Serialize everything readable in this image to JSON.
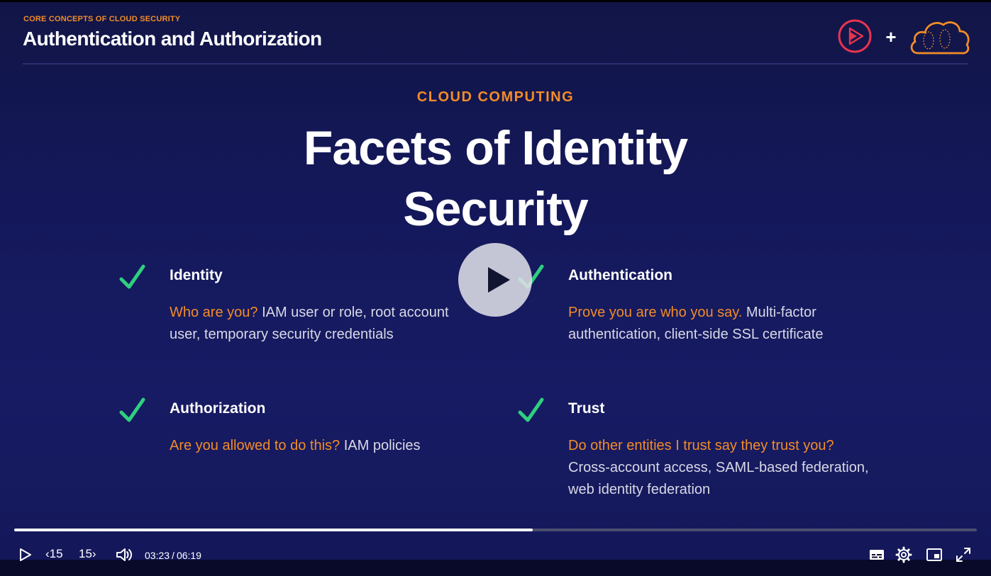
{
  "header": {
    "course_subtitle": "CORE CONCEPTS OF CLOUD SECURITY",
    "course_title": "Authentication and Authorization",
    "plus": "+"
  },
  "slide": {
    "eyebrow": "CLOUD COMPUTING",
    "headline_line1": "Facets of Identity",
    "headline_line2": "Security",
    "facets": [
      {
        "title": "Identity",
        "question": "Who are you?",
        "detail": " IAM user or role, root account user, temporary security credentials"
      },
      {
        "title": "Authentication",
        "question": "Prove you are who you say.",
        "detail": " Multi-factor authentication, client-side SSL certificate"
      },
      {
        "title": "Authorization",
        "question": "Are you allowed to do this?",
        "detail": " IAM policies"
      },
      {
        "title": "Trust",
        "question": "Do other entities I trust say they trust you?",
        "detail": " Cross-account access, SAML-based federation, web identity federation"
      }
    ]
  },
  "player": {
    "progress_fraction": 0.539,
    "skip_back_label": "15",
    "skip_forward_label": "15",
    "current_time": "03:23",
    "separator": "/",
    "duration": "06:19"
  },
  "colors": {
    "accent_orange": "#f28c28",
    "check_green": "#2fd07e",
    "background": "#14185a"
  }
}
